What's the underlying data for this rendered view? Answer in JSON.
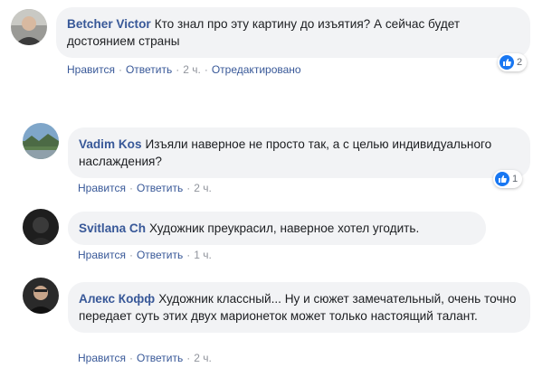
{
  "comments": [
    {
      "author": "Betcher Victor",
      "text": "Кто знал про эту картину до изъятия? А сейчас будет достоянием страны",
      "like": "Нравится",
      "reply": "Ответить",
      "time": "2 ч.",
      "edited": "Отредактировано",
      "reactions": "2",
      "avatar_icon": "avatar-photo"
    },
    {
      "author": "Vadim Kos",
      "text": "Изъяли наверное не просто так, а с целью индивидуального наслаждения?",
      "like": "Нравится",
      "reply": "Ответить",
      "time": "2 ч.",
      "reactions": "1",
      "avatar_icon": "avatar-landscape"
    },
    {
      "author": "Svitlana Ch",
      "text": "Художник преукрасил, наверное хотел угодить.",
      "like": "Нравится",
      "reply": "Ответить",
      "time": "1 ч.",
      "avatar_icon": "avatar-dark"
    },
    {
      "author": "Алекс Кофф",
      "text": "Художник классный... Ну и сюжет замечательный, очень точно передает суть этих двух марионеток может только настоящий талант.",
      "like": "Нравится",
      "reply": "Ответить",
      "time": "2 ч.",
      "avatar_icon": "avatar-photo"
    }
  ],
  "colors": {
    "link": "#385898",
    "bubble": "#f2f3f5",
    "meta": "#90949c",
    "like_badge": "#1877f2"
  },
  "separator": "·"
}
